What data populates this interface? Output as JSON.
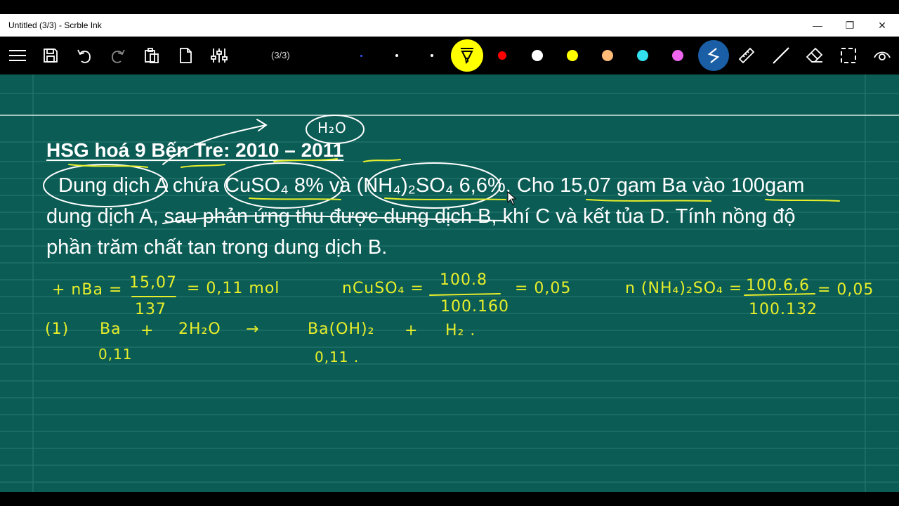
{
  "window": {
    "title": "Untitled (3/3) - Scrble Ink",
    "minimize": "—",
    "restore": "❐",
    "close": "✕"
  },
  "toolbar": {
    "page_indicator": "(3/3)",
    "icons": [
      "menu-icon",
      "save-icon",
      "undo-icon",
      "redo-icon",
      "paste-icon",
      "new-page-icon",
      "settings-sliders-icon",
      "highlighter-icon",
      "pen-icon",
      "ruler-icon",
      "line-icon",
      "eraser-icon",
      "select-icon",
      "view-icon"
    ],
    "pen_colors": [
      "#ff0000",
      "#ffffff",
      "#ffff00",
      "#ffbb77",
      "#33e0ee",
      "#ee66ee"
    ],
    "active_tool_color": "#ffff00",
    "active_pen_bg": "#1a5fa5"
  },
  "canvas": {
    "background": "#0b5c55",
    "heading": "HSG hoá 9 Bến Tre: 2010 – 2011",
    "problem_lines": [
      "Dung dịch A chứa CuSO₄ 8% và (NH₄)₂SO₄ 6,6%. Cho 15,07 gam Ba vào 100gam",
      "dung dịch A, sau phản ứng thu được dung dịch B, khí C và kết tủa D. Tính nồng độ",
      "phần trăm chất tan trong dung dịch B."
    ],
    "handwriting": {
      "h2o_bubble": "H₂O",
      "nBa_lhs": "+ nBa =",
      "nBa_num": "15,07",
      "nBa_den": "137",
      "nBa_rhs": "= 0,11 mol",
      "nCuSO4_lhs": "nCuSO₄ =",
      "nCuSO4_num": "100.8",
      "nCuSO4_den": "100.160",
      "nCuSO4_rhs": "= 0,05",
      "nNH4_lhs": "n (NH₄)₂SO₄ =",
      "nNH4_num": "100.6,6",
      "nNH4_den": "100.132",
      "nNH4_rhs": "= 0,05",
      "eq_label": "(1)",
      "eq_r1": "Ba",
      "eq_plus1": "+",
      "eq_r2": "2H₂O",
      "eq_arrow": "→",
      "eq_p1": "Ba(OH)₂",
      "eq_plus2": "+",
      "eq_p2": "H₂ .",
      "ba_mol": "0,11",
      "baoh_mol": "0,11 ."
    },
    "ink_color": "#e8ef2a"
  }
}
